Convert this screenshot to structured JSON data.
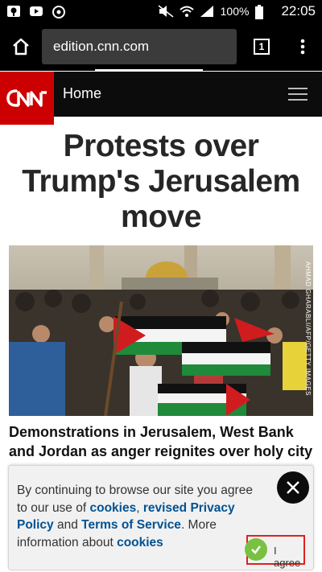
{
  "status_bar": {
    "battery": "100%",
    "time": "22:05"
  },
  "browser": {
    "url": "edition.cnn.com",
    "tab_count": "1"
  },
  "site_header": {
    "home_label": "Home"
  },
  "article": {
    "headline": "Protests over Trump's Jerusalem move",
    "photo_credit": "AHMAD GHARABLI/AFP/GETTY IMAGES",
    "subhead": "Demonstrations in Jerusalem, West Bank and Jordan as anger reignites over holy city"
  },
  "cookie_banner": {
    "text_1": "By continuing to browse our site you agree to our use of ",
    "link_cookies": "cookies",
    "sep_1": ", ",
    "link_privacy": "revised Privacy Policy",
    "text_2": " and ",
    "link_terms": "Terms of Service",
    "text_3": ". More information about ",
    "link_cookies_2": "cookies",
    "agree_label": "I agree"
  },
  "colors": {
    "cnn_red": "#cc0000",
    "link_blue": "#005293",
    "agree_green": "#7ac142"
  }
}
